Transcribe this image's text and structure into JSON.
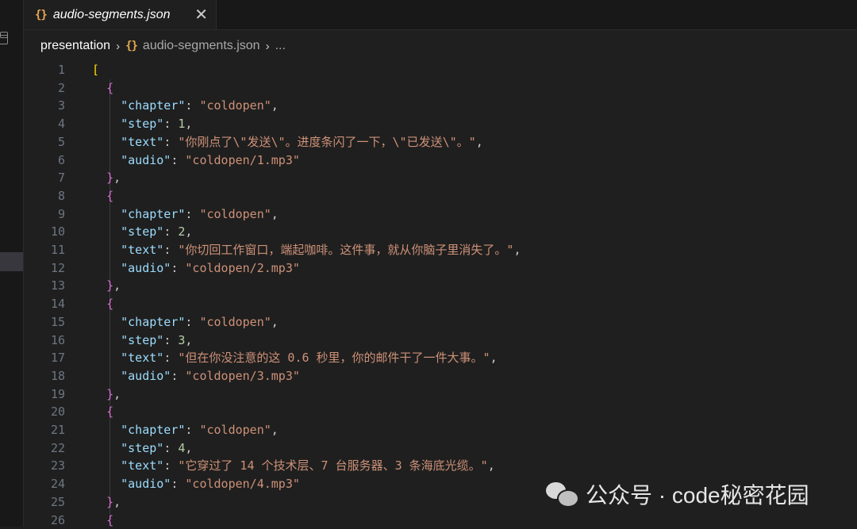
{
  "tab": {
    "title": "audio-segments.json",
    "close_glyph": "✕",
    "icon": "json-braces-icon"
  },
  "breadcrumb": {
    "root": "presentation",
    "file": "audio-segments.json",
    "more": "..."
  },
  "editor": {
    "lines": [
      {
        "n": "1",
        "tokens": [
          [
            "b1",
            "["
          ]
        ]
      },
      {
        "n": "2",
        "tokens": [
          [
            "p",
            "  "
          ],
          [
            "b2",
            "{"
          ]
        ]
      },
      {
        "n": "3",
        "tokens": [
          [
            "p",
            "    "
          ],
          [
            "key",
            "\"chapter\""
          ],
          [
            "p",
            ": "
          ],
          [
            "str",
            "\"coldopen\""
          ],
          [
            "p",
            ","
          ]
        ]
      },
      {
        "n": "4",
        "tokens": [
          [
            "p",
            "    "
          ],
          [
            "key",
            "\"step\""
          ],
          [
            "p",
            ": "
          ],
          [
            "num",
            "1"
          ],
          [
            "p",
            ","
          ]
        ]
      },
      {
        "n": "5",
        "tokens": [
          [
            "p",
            "    "
          ],
          [
            "key",
            "\"text\""
          ],
          [
            "p",
            ": "
          ],
          [
            "str",
            "\"你刚点了\\\"发送\\\"。进度条闪了一下，\\\"已发送\\\"。\""
          ],
          [
            "p",
            ","
          ]
        ]
      },
      {
        "n": "6",
        "tokens": [
          [
            "p",
            "    "
          ],
          [
            "key",
            "\"audio\""
          ],
          [
            "p",
            ": "
          ],
          [
            "str",
            "\"coldopen/1.mp3\""
          ]
        ]
      },
      {
        "n": "7",
        "tokens": [
          [
            "p",
            "  "
          ],
          [
            "b2",
            "}"
          ],
          [
            "p",
            ","
          ]
        ]
      },
      {
        "n": "8",
        "tokens": [
          [
            "p",
            "  "
          ],
          [
            "b2",
            "{"
          ]
        ]
      },
      {
        "n": "9",
        "tokens": [
          [
            "p",
            "    "
          ],
          [
            "key",
            "\"chapter\""
          ],
          [
            "p",
            ": "
          ],
          [
            "str",
            "\"coldopen\""
          ],
          [
            "p",
            ","
          ]
        ]
      },
      {
        "n": "10",
        "tokens": [
          [
            "p",
            "    "
          ],
          [
            "key",
            "\"step\""
          ],
          [
            "p",
            ": "
          ],
          [
            "num",
            "2"
          ],
          [
            "p",
            ","
          ]
        ]
      },
      {
        "n": "11",
        "tokens": [
          [
            "p",
            "    "
          ],
          [
            "key",
            "\"text\""
          ],
          [
            "p",
            ": "
          ],
          [
            "str",
            "\"你切回工作窗口，端起咖啡。这件事，就从你脑子里消失了。\""
          ],
          [
            "p",
            ","
          ]
        ]
      },
      {
        "n": "12",
        "tokens": [
          [
            "p",
            "    "
          ],
          [
            "key",
            "\"audio\""
          ],
          [
            "p",
            ": "
          ],
          [
            "str",
            "\"coldopen/2.mp3\""
          ]
        ]
      },
      {
        "n": "13",
        "tokens": [
          [
            "p",
            "  "
          ],
          [
            "b2",
            "}"
          ],
          [
            "p",
            ","
          ]
        ]
      },
      {
        "n": "14",
        "tokens": [
          [
            "p",
            "  "
          ],
          [
            "b2",
            "{"
          ]
        ]
      },
      {
        "n": "15",
        "tokens": [
          [
            "p",
            "    "
          ],
          [
            "key",
            "\"chapter\""
          ],
          [
            "p",
            ": "
          ],
          [
            "str",
            "\"coldopen\""
          ],
          [
            "p",
            ","
          ]
        ]
      },
      {
        "n": "16",
        "tokens": [
          [
            "p",
            "    "
          ],
          [
            "key",
            "\"step\""
          ],
          [
            "p",
            ": "
          ],
          [
            "num",
            "3"
          ],
          [
            "p",
            ","
          ]
        ]
      },
      {
        "n": "17",
        "tokens": [
          [
            "p",
            "    "
          ],
          [
            "key",
            "\"text\""
          ],
          [
            "p",
            ": "
          ],
          [
            "str",
            "\"但在你没注意的这 0.6 秒里，你的邮件干了一件大事。\""
          ],
          [
            "p",
            ","
          ]
        ]
      },
      {
        "n": "18",
        "tokens": [
          [
            "p",
            "    "
          ],
          [
            "key",
            "\"audio\""
          ],
          [
            "p",
            ": "
          ],
          [
            "str",
            "\"coldopen/3.mp3\""
          ]
        ]
      },
      {
        "n": "19",
        "tokens": [
          [
            "p",
            "  "
          ],
          [
            "b2",
            "}"
          ],
          [
            "p",
            ","
          ]
        ]
      },
      {
        "n": "20",
        "tokens": [
          [
            "p",
            "  "
          ],
          [
            "b2",
            "{"
          ]
        ]
      },
      {
        "n": "21",
        "tokens": [
          [
            "p",
            "    "
          ],
          [
            "key",
            "\"chapter\""
          ],
          [
            "p",
            ": "
          ],
          [
            "str",
            "\"coldopen\""
          ],
          [
            "p",
            ","
          ]
        ]
      },
      {
        "n": "22",
        "tokens": [
          [
            "p",
            "    "
          ],
          [
            "key",
            "\"step\""
          ],
          [
            "p",
            ": "
          ],
          [
            "num",
            "4"
          ],
          [
            "p",
            ","
          ]
        ]
      },
      {
        "n": "23",
        "tokens": [
          [
            "p",
            "    "
          ],
          [
            "key",
            "\"text\""
          ],
          [
            "p",
            ": "
          ],
          [
            "str",
            "\"它穿过了 14 个技术层、7 台服务器、3 条海底光缆。\""
          ],
          [
            "p",
            ","
          ]
        ]
      },
      {
        "n": "24",
        "tokens": [
          [
            "p",
            "    "
          ],
          [
            "key",
            "\"audio\""
          ],
          [
            "p",
            ": "
          ],
          [
            "str",
            "\"coldopen/4.mp3\""
          ]
        ]
      },
      {
        "n": "25",
        "tokens": [
          [
            "p",
            "  "
          ],
          [
            "b2",
            "}"
          ],
          [
            "p",
            ","
          ]
        ]
      },
      {
        "n": "26",
        "tokens": [
          [
            "p",
            "  "
          ],
          [
            "b2",
            "{"
          ]
        ]
      }
    ]
  },
  "watermark": {
    "text": "公众号 · code秘密花园",
    "icon": "wechat-icon"
  },
  "colors": {
    "background": "#1f1f1f",
    "bracket_outer": "#ffd700",
    "bracket_inner": "#da70d6",
    "json_key": "#9cdcfe",
    "json_string": "#ce9178",
    "json_number": "#b5cea8",
    "line_number": "#6e7681"
  }
}
